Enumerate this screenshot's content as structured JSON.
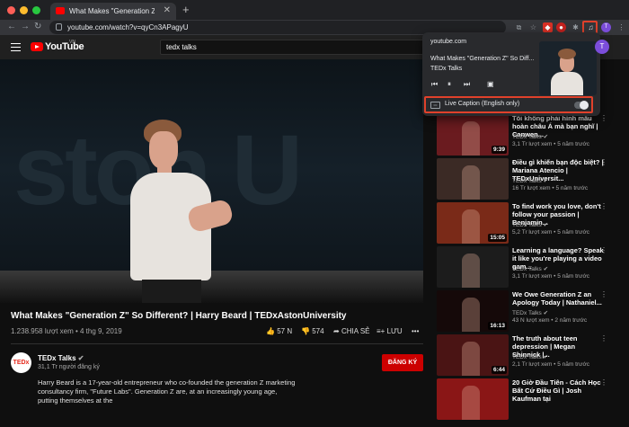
{
  "browser": {
    "tab_title": "What Makes \"Generation Z\"",
    "tab_close": "✕",
    "new_tab": "+",
    "url": "youtube.com/watch?v=qyCn3APagyU",
    "profile_initial": "T",
    "colors": {
      "close": "#ff5f57",
      "minimize": "#febc2e",
      "zoom": "#28c840"
    }
  },
  "youtube": {
    "logo_text": "YouTube",
    "country": "VN",
    "search_value": "tedx talks"
  },
  "video": {
    "backdrop_text": "ston U",
    "title": "What Makes \"Generation Z\" So Different? | Harry Beard | TEDxAstonUniversity",
    "views_date": "1.238.958 lượt xem • 4 thg 9, 2019",
    "likes": "57 N",
    "dislikes": "574",
    "share": "CHIA SẺ",
    "save": "LƯU",
    "more": "•••"
  },
  "channel": {
    "avatar_text": "TEDx",
    "name": "TEDx Talks",
    "subscribers": "31,1 Tr người đăng ký",
    "subscribe": "ĐĂNG KÝ",
    "description": "Harry Beard is a 17-year-old entrepreneur who co-founded the generation Z marketing consultancy firm, \"Future Labs\". Generation Z are, at an increasingly young age, putting themselves at the"
  },
  "popup": {
    "domain": "youtube.com",
    "title": "What Makes \"Generation Z\" So Diff...",
    "channel": "TEDx Talks",
    "caption_label": "Live Caption (English only)",
    "caption_on": false
  },
  "recommendations": [
    {
      "title": "Tôi không phải hình mẫu hoàn châu Á mà bạn nghĩ | Canwen...",
      "channel": "TEDx Talks",
      "views": "3,1 Tr lượt xem • 5 năm trước",
      "duration": "9:39",
      "color": "#6a1b1f"
    },
    {
      "title": "Điều gì khiến bạn độc biệt? | Mariana Atencio | TEDxUniversit...",
      "channel": "TEDx Talks",
      "views": "16 Tr lượt xem • 5 năm trước",
      "duration": "",
      "color": "#3b2a25"
    },
    {
      "title": "To find work you love, don't follow your passion | Benjamin...",
      "channel": "TEDx Talks",
      "views": "5,2 Tr lượt xem • 5 năm trước",
      "duration": "15:05",
      "color": "#7a2a18"
    },
    {
      "title": "Learning a language? Speak it like you're playing a video gam...",
      "channel": "TEDx Talks",
      "views": "3,1 Tr lượt xem • 5 năm trước",
      "duration": "",
      "color": "#1c1c1c"
    },
    {
      "title": "We Owe Generation Z an Apology Today | Nathaniel...",
      "channel": "TEDx Talks",
      "views": "43 N lượt xem • 2 năm trước",
      "duration": "16:13",
      "color": "#150909"
    },
    {
      "title": "The truth about teen depression | Megan Shinnick |...",
      "channel": "TEDx Talks",
      "views": "2,1 Tr lượt xem • 5 năm trước",
      "duration": "6:44",
      "color": "#4a1414"
    },
    {
      "title": "20 Giờ Đầu Tiên - Cách Học Bất Cứ Điều Gì | Josh Kaufman tại",
      "channel": "",
      "views": "",
      "duration": "",
      "color": "#8a1616"
    }
  ]
}
